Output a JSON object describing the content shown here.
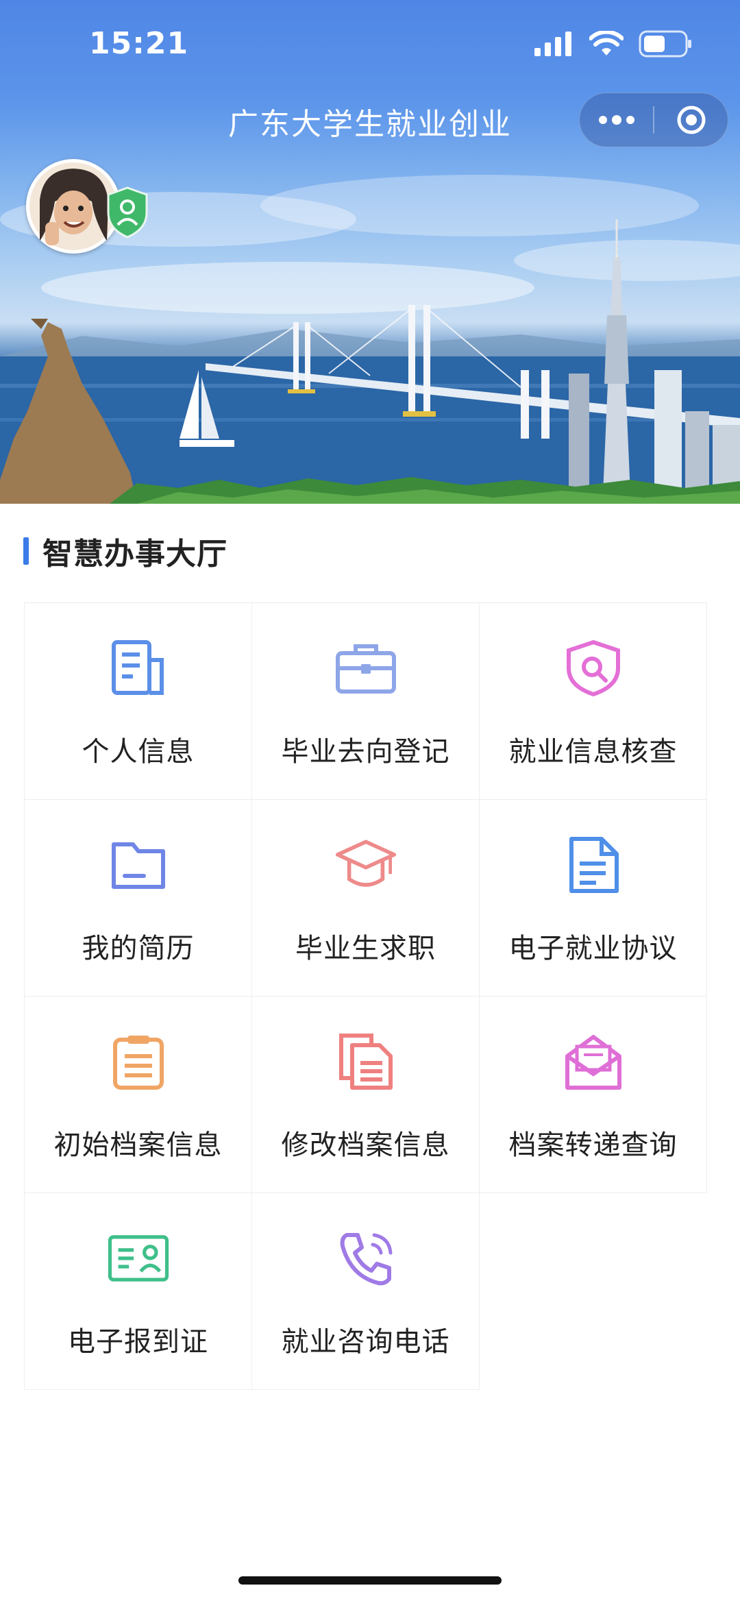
{
  "status_bar": {
    "time": "15:21",
    "icons": [
      "signal-icon",
      "wifi-icon",
      "battery-icon"
    ]
  },
  "nav": {
    "title": "广东大学生就业创业",
    "menu_icon": "more-dots-icon",
    "close_icon": "target-circle-icon"
  },
  "section": {
    "title": "智慧办事大厅",
    "accent_color": "#3b7be8"
  },
  "services": [
    {
      "label": "个人信息",
      "icon": "document-icon",
      "color": "#5b8fe8"
    },
    {
      "label": "毕业去向登记",
      "icon": "briefcase-icon",
      "color": "#8ea6e8"
    },
    {
      "label": "就业信息核查",
      "icon": "shield-search-icon",
      "color": "#e46fd6"
    },
    {
      "label": "我的简历",
      "icon": "folder-icon",
      "color": "#6f86e6"
    },
    {
      "label": "毕业生求职",
      "icon": "graduation-cap-icon",
      "color": "#ee8a8a"
    },
    {
      "label": "电子就业协议",
      "icon": "file-text-icon",
      "color": "#4f8fe8"
    },
    {
      "label": "初始档案信息",
      "icon": "clipboard-icon",
      "color": "#f0a565"
    },
    {
      "label": "修改档案信息",
      "icon": "copy-files-icon",
      "color": "#ef8080"
    },
    {
      "label": "档案转递查询",
      "icon": "mail-open-icon",
      "color": "#df6fd6"
    },
    {
      "label": "电子报到证",
      "icon": "id-card-icon",
      "color": "#3fbf8a"
    },
    {
      "label": "就业咨询电话",
      "icon": "phone-call-icon",
      "color": "#a07be6"
    }
  ]
}
